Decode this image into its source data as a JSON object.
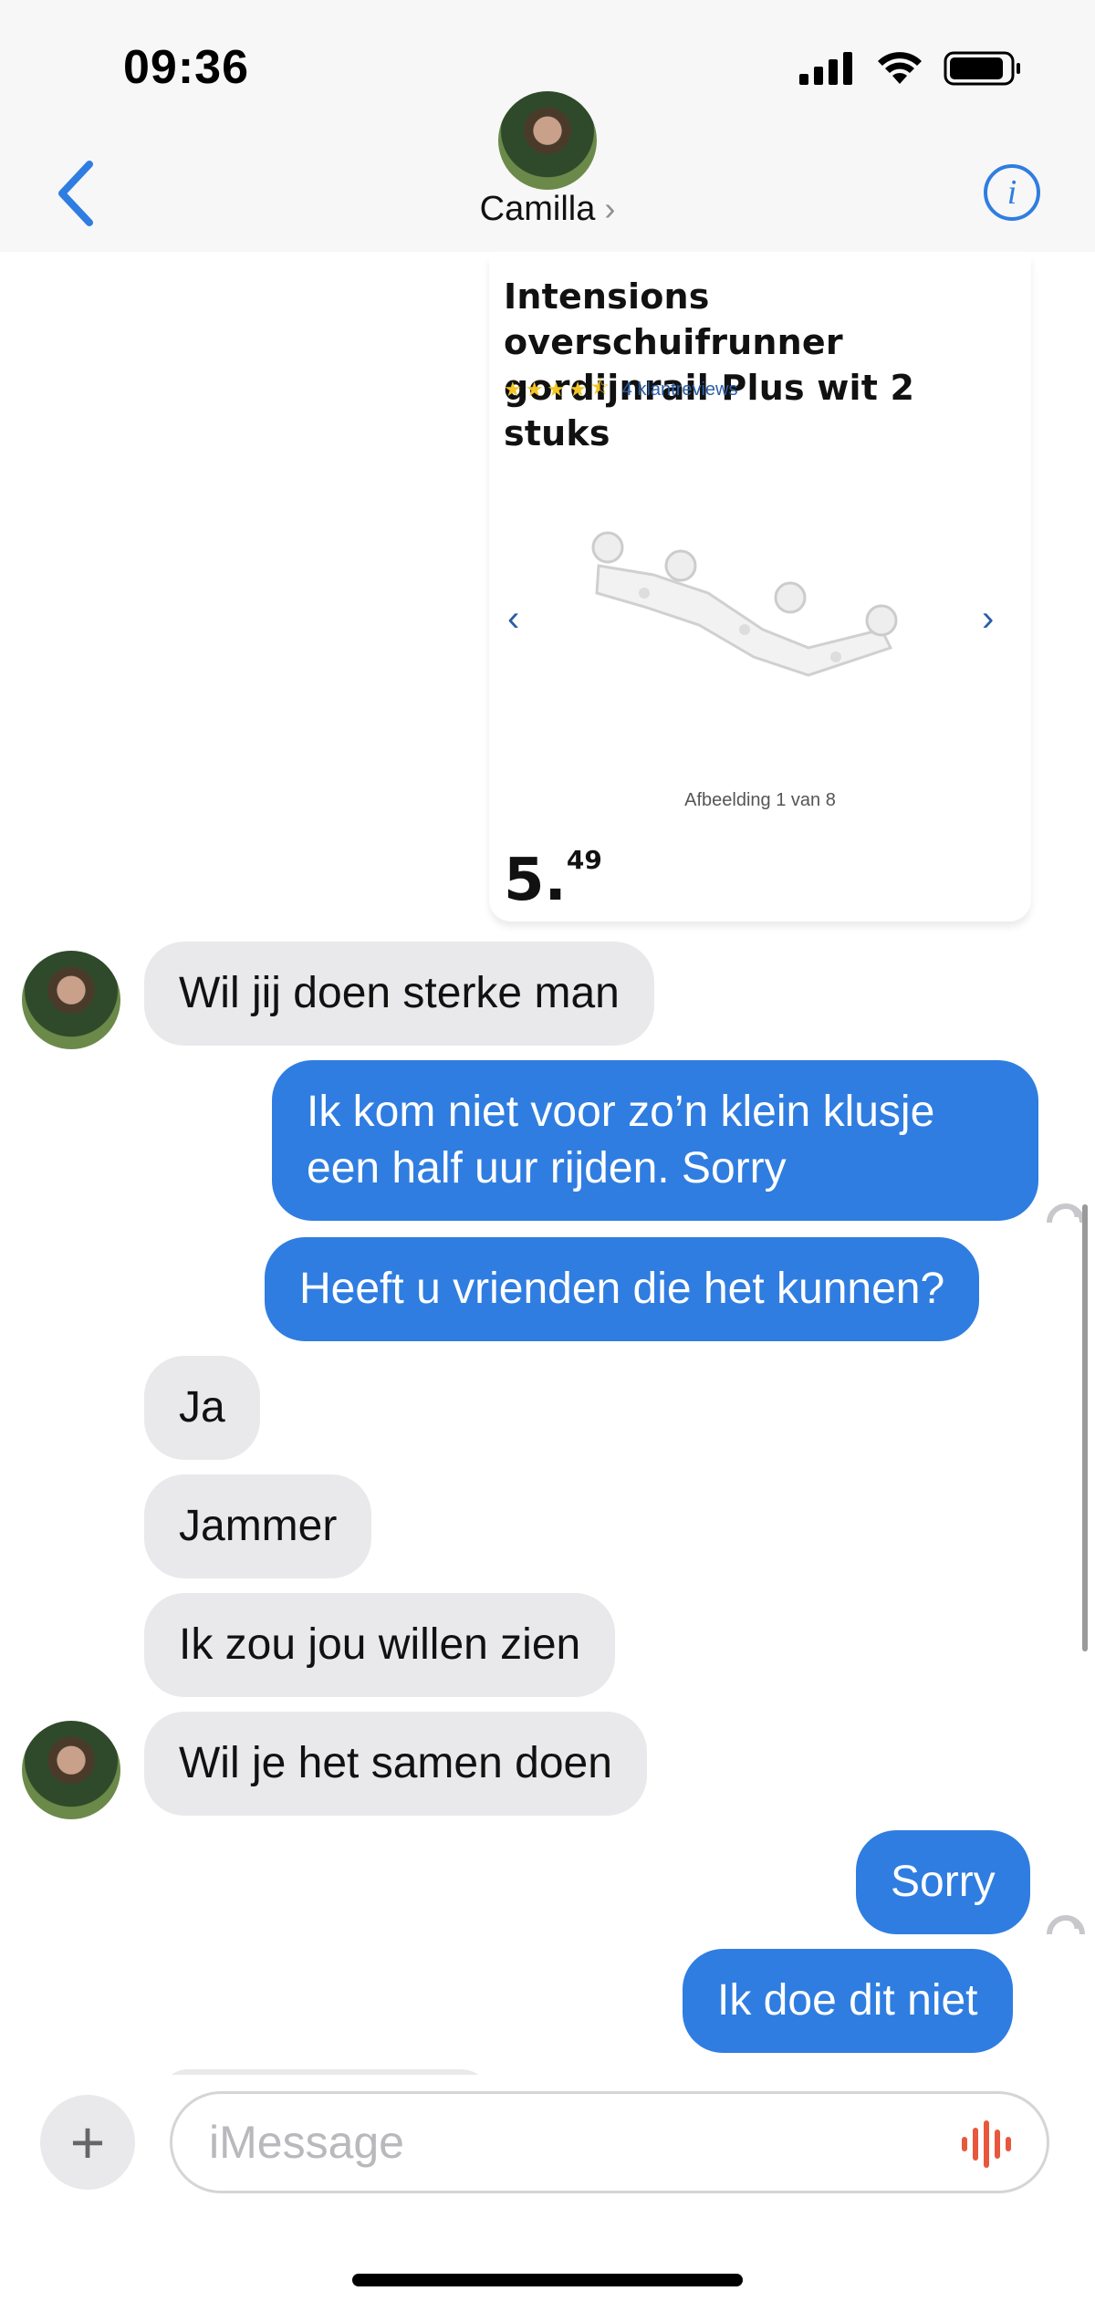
{
  "status_bar": {
    "time": "09:36"
  },
  "header": {
    "contact_name": "Camilla",
    "name_chevron": "›",
    "back_icon": "chevron-left-icon",
    "info_icon": "info-icon",
    "info_glyph": "i"
  },
  "product_card": {
    "title": "Intensions overschuifrunner gordijnrail Plus wit 2 stuks",
    "rating": 4.5,
    "reviews": "4 klantreviews",
    "image_caption": "Afbeelding 1 van 8",
    "price_main": "5.",
    "price_cents": "49",
    "prev_arrow": "‹",
    "next_arrow": "›"
  },
  "messages": [
    {
      "direction": "incoming",
      "text": "Wil jij doen sterke man"
    },
    {
      "direction": "outgoing",
      "text": "Ik kom niet voor zo’n klein klusje een half uur rijden. Sorry"
    },
    {
      "direction": "outgoing",
      "text": "Heeft u vrienden die het kunnen?"
    },
    {
      "direction": "incoming",
      "text": "Ja"
    },
    {
      "direction": "incoming",
      "text": "Jammer"
    },
    {
      "direction": "incoming",
      "text": "Ik zou jou willen zien"
    },
    {
      "direction": "incoming",
      "text": "Wil je het samen doen"
    },
    {
      "direction": "outgoing",
      "text": "Sorry"
    },
    {
      "direction": "outgoing",
      "text": "Ik doe dit niet"
    }
  ],
  "composer": {
    "placeholder": "iMessage",
    "plus_glyph": "+"
  },
  "colors": {
    "accent": "#2f7de1",
    "incoming_bubble": "#e9e9eb",
    "audio": "#e8573c"
  }
}
